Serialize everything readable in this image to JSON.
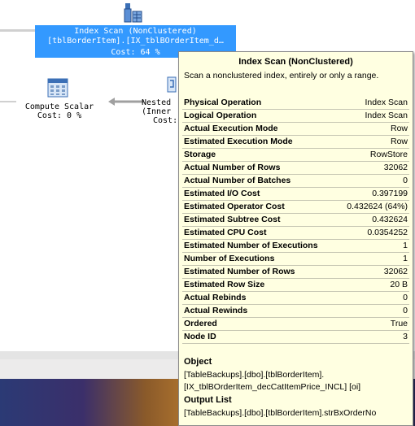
{
  "selected_node": {
    "line1": "Index Scan (NonClustered)",
    "line2": "[tblBorderItem].[IX_tblBOrderItem_d…",
    "line3": "Cost: 64 %"
  },
  "compute_scalar": {
    "label": "Compute Scalar",
    "cost": "Cost: 0 %"
  },
  "nested": {
    "label": "Nested",
    "sub": "(Inner",
    "cost": "Cost:"
  },
  "tooltip": {
    "title": "Index Scan (NonClustered)",
    "description": "Scan a nonclustered index, entirely or only a range.",
    "rows": [
      {
        "k": "Physical Operation",
        "v": "Index Scan"
      },
      {
        "k": "Logical Operation",
        "v": "Index Scan"
      },
      {
        "k": "Actual Execution Mode",
        "v": "Row"
      },
      {
        "k": "Estimated Execution Mode",
        "v": "Row"
      },
      {
        "k": "Storage",
        "v": "RowStore"
      },
      {
        "k": "Actual Number of Rows",
        "v": "32062"
      },
      {
        "k": "Actual Number of Batches",
        "v": "0"
      },
      {
        "k": "Estimated I/O Cost",
        "v": "0.397199"
      },
      {
        "k": "Estimated Operator Cost",
        "v": "0.432624 (64%)"
      },
      {
        "k": "Estimated Subtree Cost",
        "v": "0.432624"
      },
      {
        "k": "Estimated CPU Cost",
        "v": "0.0354252"
      },
      {
        "k": "Estimated Number of Executions",
        "v": "1"
      },
      {
        "k": "Number of Executions",
        "v": "1"
      },
      {
        "k": "Estimated Number of Rows",
        "v": "32062"
      },
      {
        "k": "Estimated Row Size",
        "v": "20 B"
      },
      {
        "k": "Actual Rebinds",
        "v": "0"
      },
      {
        "k": "Actual Rewinds",
        "v": "0"
      },
      {
        "k": "Ordered",
        "v": "True"
      },
      {
        "k": "Node ID",
        "v": "3"
      }
    ],
    "object_heading": "Object",
    "object_line1": "[TableBackups].[dbo].[tblBorderItem].",
    "object_line2": "[IX_tblBOrderItem_decCatItemPrice_INCL] [oi]",
    "output_heading": "Output List",
    "output_line1": "[TableBackups].[dbo].[tblBorderItem].strBxOrderNo"
  }
}
